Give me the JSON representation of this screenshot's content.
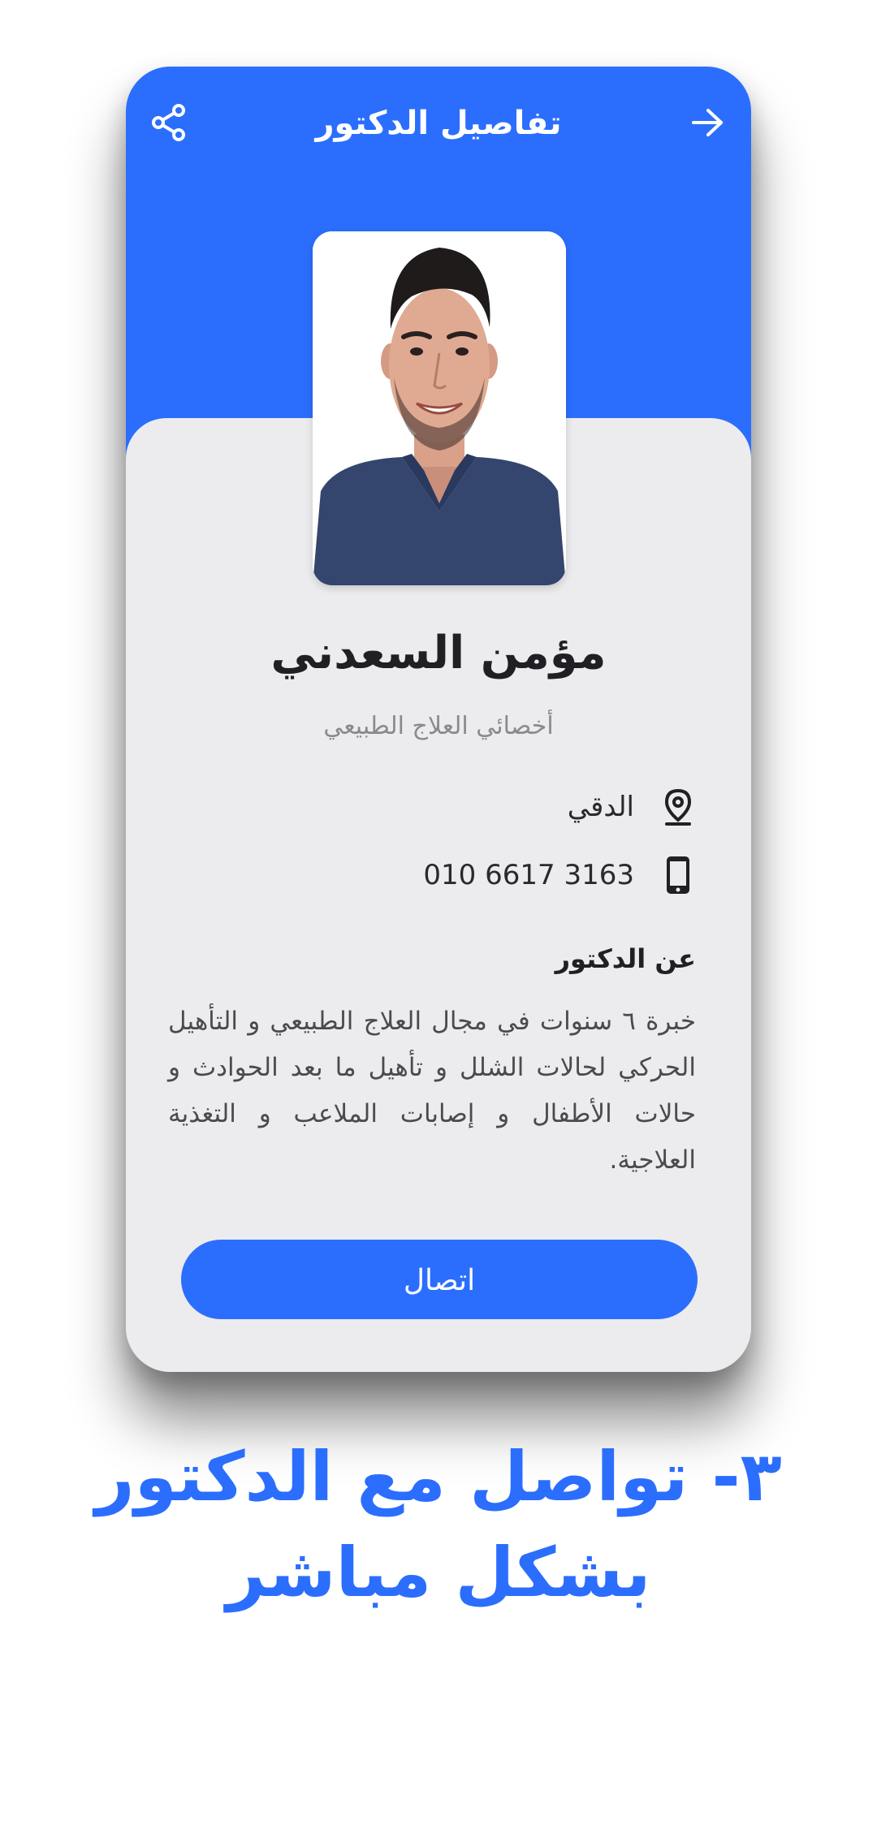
{
  "header": {
    "title": "تفاصيل الدكتور",
    "share_icon": "share-icon",
    "back_icon": "arrow-right-icon",
    "color": "#2b6efd"
  },
  "doctor": {
    "photo": "doctor-photo",
    "name": "مؤمن السعدني",
    "specialty": "أخصائي العلاج الطبيعي",
    "location": "الدقي",
    "location_icon": "location-pin-icon",
    "phone": "010 6617 3163",
    "phone_icon": "mobile-phone-icon"
  },
  "about": {
    "title": "عن الدكتور",
    "body": "خبرة ٦ سنوات في مجال العلاج الطبيعي و التأهيل الحركي لحالات الشلل و تأهيل ما بعد الحوادث و حالات الأطفال و إصابات الملاعب و التغذية العلاجية."
  },
  "actions": {
    "call_label": "اتصال"
  },
  "caption": {
    "line1": "٣- تواصل مع الدكتور",
    "line2": "بشكل مباشر"
  }
}
